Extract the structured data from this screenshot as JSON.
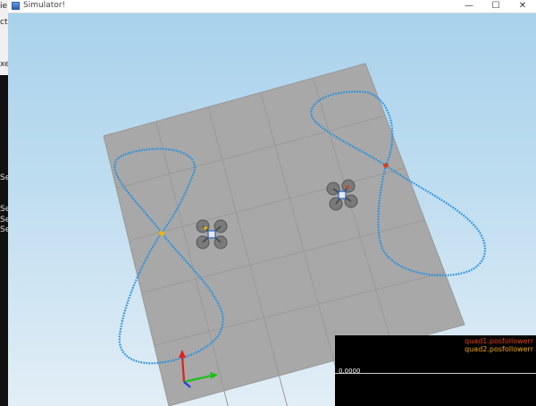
{
  "window": {
    "title": "Simulator!",
    "controls": {
      "minimize": "—",
      "maximize": "☐",
      "close": "✕"
    }
  },
  "background_window": {
    "snippets": [
      "ie",
      "ct",
      "xe",
      "Se",
      "Se",
      "Se",
      "Se"
    ]
  },
  "scene": {
    "trajectory_color": "#1f8fe0",
    "quad1_color": "#d0421a",
    "quad2_color": "#f0b400",
    "floor_color": "#a8a8a8"
  },
  "graph": {
    "legend": [
      "quad1.posfollowerr",
      "quad2.posfollowerr"
    ],
    "legend_colors": [
      "#e8420a",
      "#f5a800"
    ],
    "zero_label": "0.0000"
  }
}
